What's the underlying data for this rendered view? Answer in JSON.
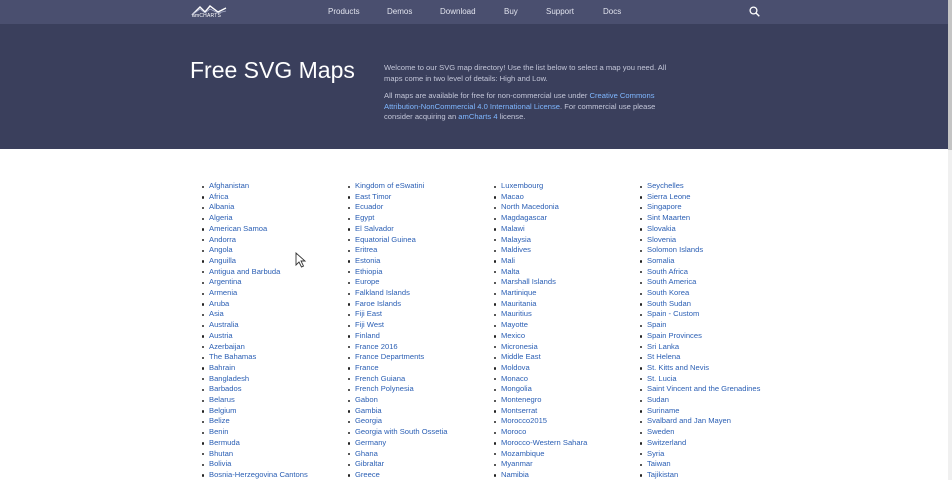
{
  "header": {
    "logo_text": "amCHARTS",
    "nav": [
      "Products",
      "Demos",
      "Download",
      "Buy",
      "Support",
      "Docs"
    ],
    "search_icon": "search-icon"
  },
  "hero": {
    "title": "Free SVG Maps",
    "para1": "Welcome to our SVG map directory! Use the list below to select a map you need. All maps come in two level of details: High and Low.",
    "para2_pre": "All maps are available for free for non-commercial use under ",
    "para2_link1": "Creative Commons Attribution-NonCommercial 4.0 International License",
    "para2_mid": ". For commercial use please consider acquiring an ",
    "para2_link2": "amCharts 4",
    "para2_post": " license."
  },
  "maps": {
    "col1": [
      "Afghanistan",
      "Africa",
      "Albania",
      "Algeria",
      "American Samoa",
      "Andorra",
      "Angola",
      "Anguilla",
      "Antigua and Barbuda",
      "Argentina",
      "Armenia",
      "Aruba",
      "Asia",
      "Australia",
      "Austria",
      "Azerbaijan",
      "The Bahamas",
      "Bahrain",
      "Bangladesh",
      "Barbados",
      "Belarus",
      "Belgium",
      "Belize",
      "Benin",
      "Bermuda",
      "Bhutan",
      "Bolivia",
      "Bosnia-Herzegovina Cantons"
    ],
    "col2": [
      "Kingdom of eSwatini",
      "East Timor",
      "Ecuador",
      "Egypt",
      "El Salvador",
      "Equatorial Guinea",
      "Eritrea",
      "Estonia",
      "Ethiopia",
      "Europe",
      "Falkland Islands",
      "Faroe Islands",
      "Fiji East",
      "Fiji West",
      "Finland",
      "France 2016",
      "France Departments",
      "France",
      "French Guiana",
      "French Polynesia",
      "Gabon",
      "Gambia",
      "Georgia",
      "Georgia with South Ossetia",
      "Germany",
      "Ghana",
      "Gibraltar",
      "Greece"
    ],
    "col3": [
      "Luxembourg",
      "Macao",
      "North Macedonia",
      "Magdagascar",
      "Malawi",
      "Malaysia",
      "Maldives",
      "Mali",
      "Malta",
      "Marshall Islands",
      "Martinique",
      "Mauritania",
      "Mauritius",
      "Mayotte",
      "Mexico",
      "Micronesia",
      "Middle East",
      "Moldova",
      "Monaco",
      "Mongolia",
      "Montenegro",
      "Montserrat",
      "Morocco2015",
      "Moroco",
      "Morocco-Western Sahara",
      "Mozambique",
      "Myanmar",
      "Namibia"
    ],
    "col4": [
      "Seychelles",
      "Sierra Leone",
      "Singapore",
      "Sint Maarten",
      "Slovakia",
      "Slovenia",
      "Solomon Islands",
      "Somalia",
      "South Africa",
      "South America",
      "South Korea",
      "South Sudan",
      "Spain - Custom",
      "Spain",
      "Spain Provinces",
      "Sri Lanka",
      "St Helena",
      "St. Kitts and Nevis",
      "St. Lucia",
      "Saint Vincent and the Grenadines",
      "Sudan",
      "Suriname",
      "Svalbard and Jan Mayen",
      "Sweden",
      "Switzerland",
      "Syria",
      "Taiwan",
      "Tajikistan"
    ]
  },
  "colors": {
    "nav_bg": "#4a4f6f",
    "hero_bg": "#3a3f5c",
    "link": "#2b5fb4"
  }
}
